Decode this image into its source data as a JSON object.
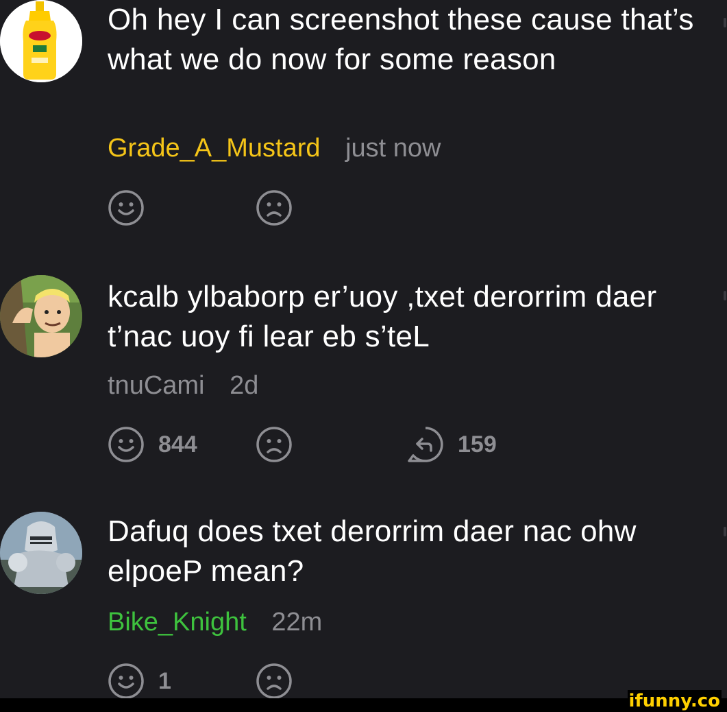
{
  "comments": [
    {
      "text": "Oh hey I can screenshot these cause that’s what we do now for some reason",
      "username": "Grade_A_Mustard",
      "username_color": "#f5c518",
      "time": "just now",
      "smile_count": "",
      "reply_count": "",
      "avatar": "mustard-bottle"
    },
    {
      "text": "kcalb ylbaborp er’uoy ,txet derorrim daer t’nac uoy fi lear eb s’teL",
      "username": "tnuCami",
      "username_color": "#8e8e93",
      "time": "2d",
      "smile_count": "844",
      "reply_count": "159",
      "avatar": "cartoon-man"
    },
    {
      "text": "Dafuq does txet derorrim daer nac ohw elpoeP mean?",
      "username": "Bike_Knight",
      "username_color": "#3ec23e",
      "time": "22m",
      "smile_count": "1",
      "reply_count": "",
      "avatar": "armored-knight"
    }
  ],
  "watermark": "ifunny.co",
  "colors": {
    "background": "#1c1c20",
    "text": "#ffffff",
    "muted": "#8e8e93",
    "watermark": "#ffd000"
  }
}
